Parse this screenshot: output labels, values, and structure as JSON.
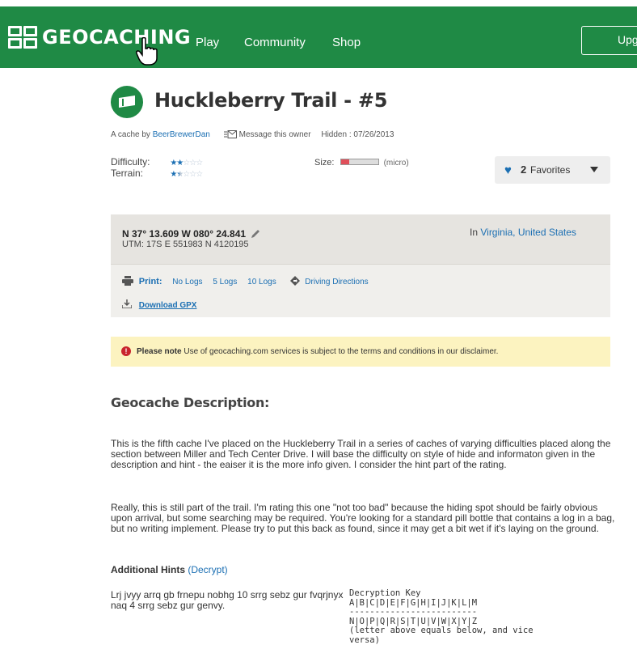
{
  "nav": {
    "logo_text": "GEOCACHING",
    "links": [
      "Play",
      "Community",
      "Shop"
    ],
    "upgrade_label": "Upgrade"
  },
  "cache": {
    "title": "Huckleberry Trail - #5",
    "byline_prefix": "A cache by",
    "owner": "BeerBrewerDan",
    "message_owner": "Message this owner",
    "hidden": "Hidden : 07/26/2013",
    "difficulty_label": "Difficulty:",
    "terrain_label": "Terrain:",
    "difficulty_stars": {
      "filled": "★★",
      "empty": "☆☆☆",
      "value": 2
    },
    "terrain_stars": {
      "filled": "★",
      "half": "★",
      "empty": "☆☆☆",
      "value": 1.5
    },
    "size_label": "Size:",
    "size_value": "(micro)",
    "favorites_count": "2",
    "favorites_label": "Favorites"
  },
  "coords": {
    "text": "N 37° 13.609 W 080° 24.841",
    "utm": "UTM: 17S E 551983 N 4120195",
    "location_prefix": "In",
    "location": "Virginia, United States",
    "print_label": "Print:",
    "print_options": [
      "No Logs",
      "5 Logs",
      "10 Logs"
    ],
    "driving_directions": "Driving Directions",
    "download_gpx": "Download GPX"
  },
  "notice": {
    "bold": "Please note",
    "text": "Use of geocaching.com services is subject to the terms and conditions in our disclaimer."
  },
  "description": {
    "heading": "Geocache Description:",
    "para1": "This is the fifth cache I've placed on the Huckleberry Trail in a series of caches of varying difficulties placed along the section between Miller and Tech Center Drive. I will base the difficulty on style of hide and informaton given in the description and hint - the eaiser it is the more info given. I consider the hint part of the rating.",
    "para2": "Really, this is still part of the trail.  I'm rating this one \"not too bad\" because the hiding spot should be fairly obvious upon arrival, but some searching may be required.  You're looking for a standard pill bottle that contains a log in a bag, but no writing implement.  Please try to put this back as found, since it may get a bit wet if it's laying on the ground."
  },
  "hints": {
    "heading": "Additional Hints",
    "decrypt_link": "(Decrypt)",
    "text": "Lrj jvyy arrq gb frnepu nobhg 10 srrg sebz gur fvqrjnyx naq 4 srrg sebz gur genvy.",
    "key_title": "Decryption Key",
    "key_row1": "A|B|C|D|E|F|G|H|I|J|K|L|M",
    "key_sep": "-------------------------",
    "key_row2": "N|O|P|Q|R|S|T|U|V|W|X|Y|Z",
    "key_note1": "(letter above equals below, and vice",
    "key_note2": "versa)"
  }
}
